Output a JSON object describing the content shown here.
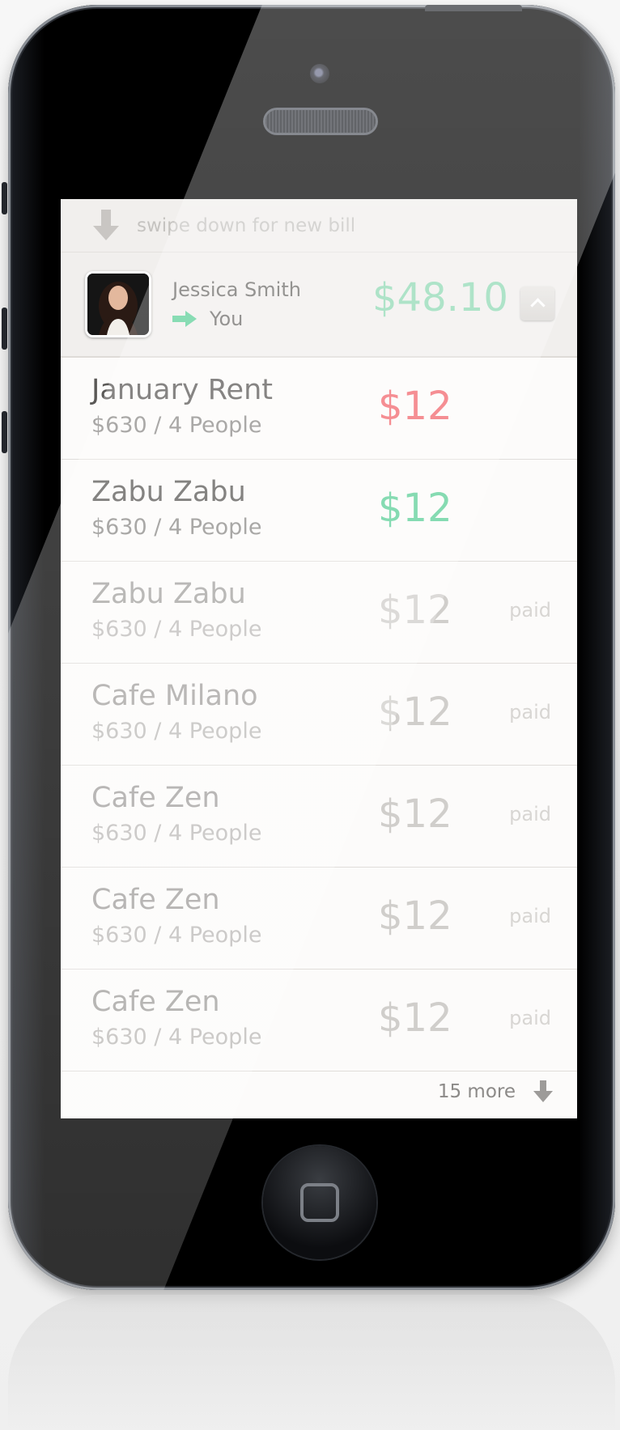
{
  "header": {
    "swipe_hint": "swipe down for new bill",
    "user": {
      "name": "Jessica Smith",
      "direction_label": "You",
      "amount": "$48.10"
    }
  },
  "bills": [
    {
      "name": "January Rent",
      "detail": "$630 / 4 People",
      "amount": "$12",
      "status": "",
      "state": "owed",
      "color": "#f2666c"
    },
    {
      "name": "Zabu Zabu",
      "detail": "$630 / 4 People",
      "amount": "$12",
      "status": "",
      "state": "owing",
      "color": "#5ccf98"
    },
    {
      "name": "Zabu Zabu",
      "detail": "$630 / 4 People",
      "amount": "$12",
      "status": "paid",
      "state": "paid"
    },
    {
      "name": "Cafe Milano",
      "detail": "$630 / 4 People",
      "amount": "$12",
      "status": "paid",
      "state": "paid"
    },
    {
      "name": "Cafe Zen",
      "detail": "$630 / 4 People",
      "amount": "$12",
      "status": "paid",
      "state": "paid"
    },
    {
      "name": "Cafe Zen",
      "detail": "$630 / 4 People",
      "amount": "$12",
      "status": "paid",
      "state": "paid"
    },
    {
      "name": "Cafe Zen",
      "detail": "$630 / 4 People",
      "amount": "$12",
      "status": "paid",
      "state": "paid"
    }
  ],
  "footer": {
    "more_label": "15 more"
  },
  "icons": {
    "swipe": "arrow-down-icon",
    "direction": "arrow-right-icon",
    "collapse": "chevron-up-icon",
    "more": "arrow-down-icon"
  },
  "colors": {
    "accent_green": "#5ccf98",
    "accent_red": "#f2666c",
    "total_amount": "#8fd9b4"
  }
}
